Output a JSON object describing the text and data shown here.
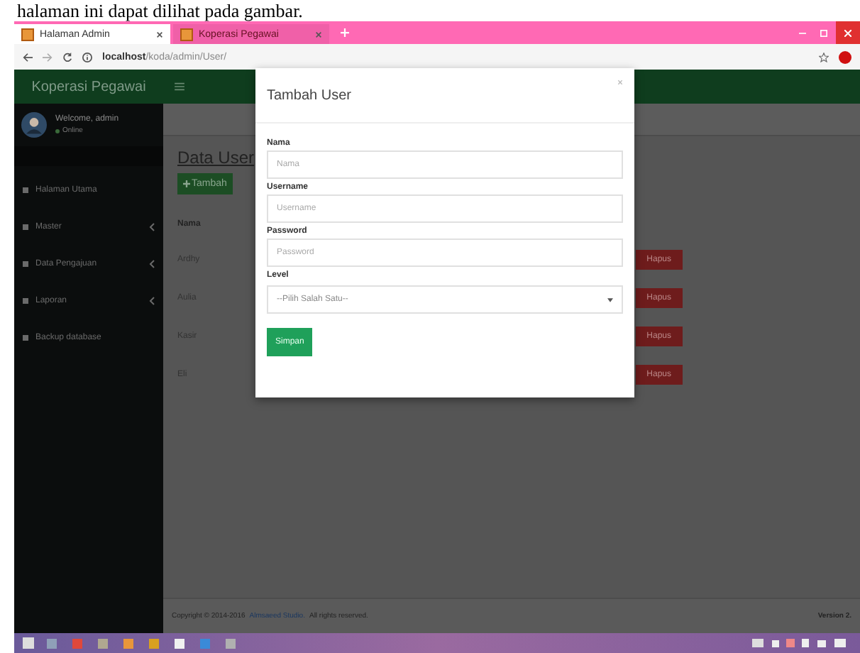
{
  "caption": "halaman ini dapat dilihat pada gambar.",
  "browser": {
    "tabs": [
      {
        "title": "Halaman Admin",
        "selected": true
      },
      {
        "title": "Koperasi Pegawai",
        "selected": false
      }
    ],
    "url_host": "localhost",
    "url_path": "/koda/admin/User/"
  },
  "app": {
    "brand": "Koperasi Pegawai",
    "user": {
      "name": "Welcome, admin",
      "status": "Online"
    },
    "menu": [
      {
        "label": "Halaman Utama",
        "has_children": false
      },
      {
        "label": "Master",
        "has_children": true
      },
      {
        "label": "Data Pengajuan",
        "has_children": true
      },
      {
        "label": "Laporan",
        "has_children": true
      },
      {
        "label": "Backup database",
        "has_children": false
      }
    ],
    "page_title": "Data User",
    "add_button": "Tambah",
    "table": {
      "columns": [
        "Nama"
      ],
      "rows": [
        {
          "name": "Ardhy",
          "action": "Hapus"
        },
        {
          "name": "Aulia",
          "action": "Hapus"
        },
        {
          "name": "Kasir",
          "action": "Hapus"
        },
        {
          "name": "Eli",
          "action": "Hapus"
        }
      ]
    },
    "footer": {
      "copyright": "Copyright © 2014-2016",
      "link": "Almsaeed Studio.",
      "rights": "All rights reserved.",
      "version": "Version 2."
    }
  },
  "modal": {
    "title": "Tambah User",
    "fields": [
      {
        "label": "Nama",
        "placeholder": "Nama",
        "kind": "input"
      },
      {
        "label": "Username",
        "placeholder": "Username",
        "kind": "input"
      },
      {
        "label": "Password",
        "placeholder": "Password",
        "kind": "input"
      },
      {
        "label": "Level",
        "placeholder": "--Pilih Salah Satu--",
        "kind": "select"
      }
    ],
    "submit": "Simpan"
  }
}
